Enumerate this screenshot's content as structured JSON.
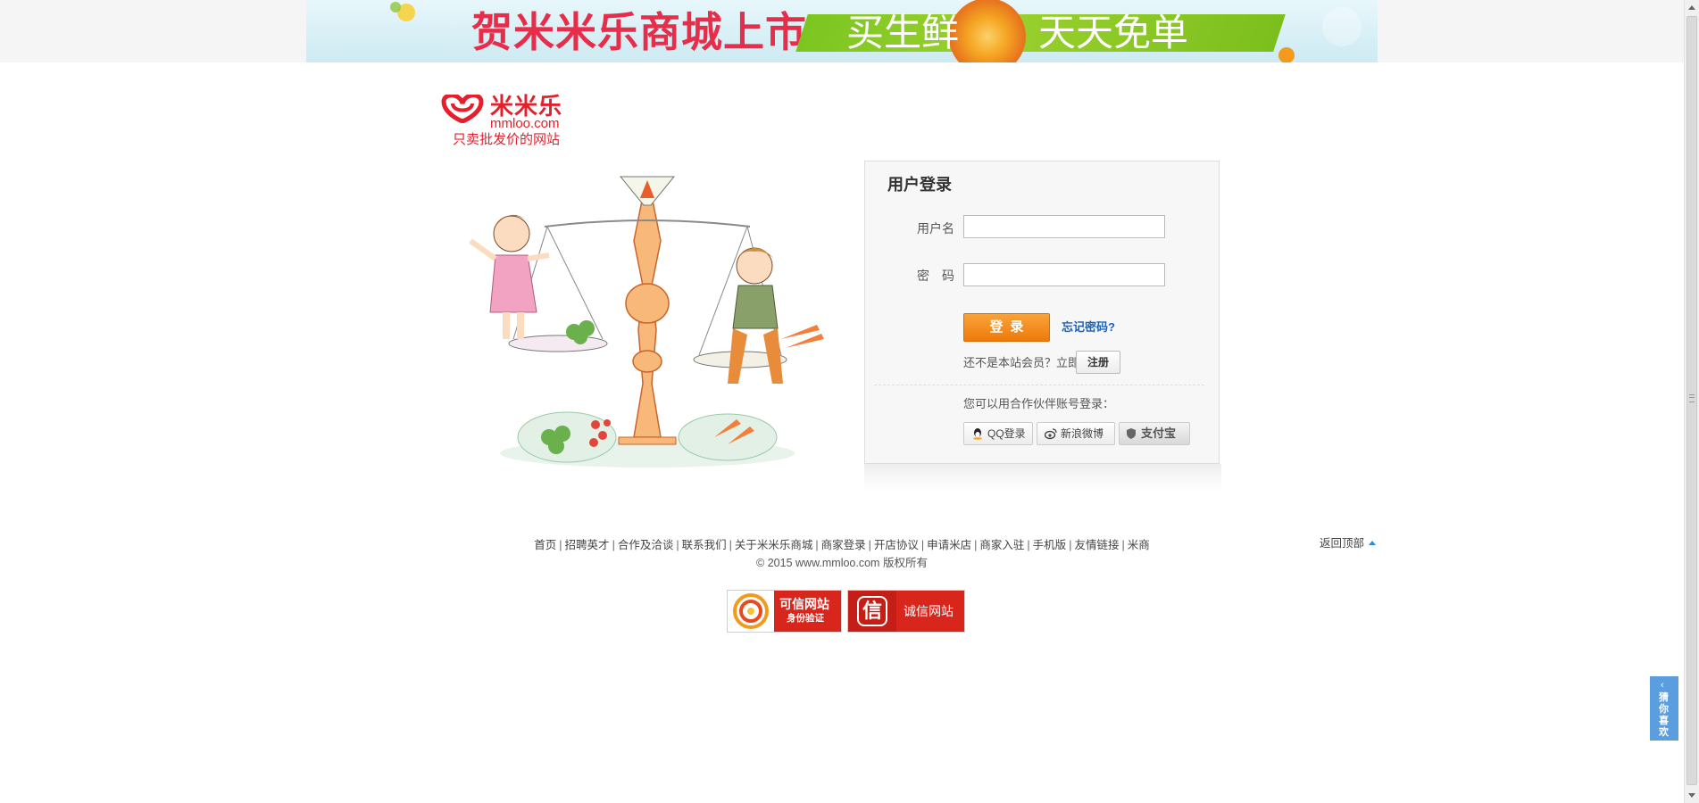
{
  "banner": {
    "title": "贺米米乐商城上市",
    "sub1": "买生鲜",
    "sub2": "天天免单"
  },
  "logo": {
    "name": "米米乐",
    "domain": "mmloo.com",
    "slogan": "只卖批发价的网站"
  },
  "login": {
    "title": "用户登录",
    "username_label": "用户名",
    "username_value": "",
    "password_label": "密　码",
    "password_value": "",
    "login_button": "登录",
    "forgot_link": "忘记密码?",
    "not_member_text": "还不是本站会员？立即",
    "register_button": "注册",
    "partner_hint": "您可以用合作伙伴账号登录：",
    "partners": {
      "qq": "QQ登录",
      "weibo": "新浪微博",
      "alipay": "支付宝"
    }
  },
  "footer": {
    "links": [
      "首页",
      "招聘英才",
      "合作及洽谈",
      "联系我们",
      "关于米米乐商城",
      "商家登录",
      "开店协议",
      "申请米店",
      "商家入驻",
      "手机版",
      "友情链接",
      "米商"
    ],
    "copyright": "© 2015 www.mmloo.com 版权所有",
    "back_to_top": "返回顶部"
  },
  "badges": {
    "trusted_title": "可信网站",
    "trusted_sub": "身份验证",
    "integrity_icon": "信",
    "integrity_title": "诚信网站"
  },
  "side_tab": {
    "arrow": "‹",
    "text": "猜你喜欢"
  },
  "colors": {
    "brand_red": "#e3202c",
    "login_orange": "#f08a18",
    "link_blue": "#1c62b9",
    "side_tab_blue": "#5b9ee0"
  }
}
